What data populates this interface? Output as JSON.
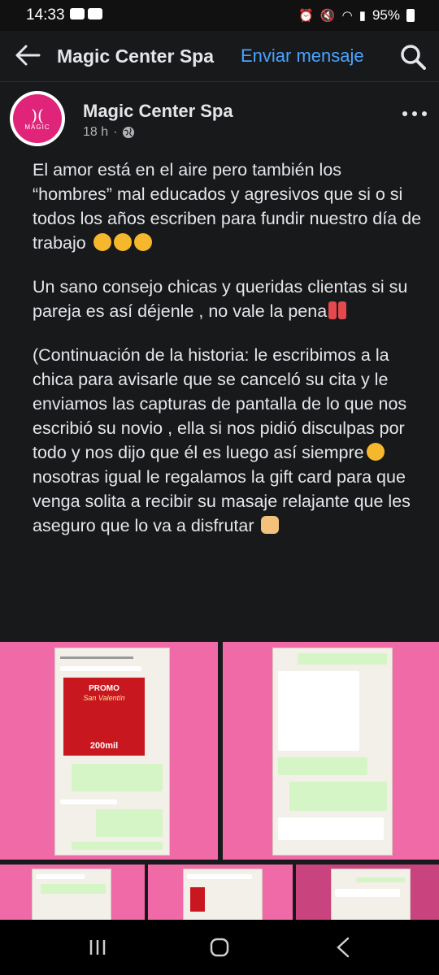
{
  "status_bar": {
    "time": "14:33",
    "battery": "95%"
  },
  "app_bar": {
    "title": "Magic Center Spa",
    "send_message": "Enviar mensaje"
  },
  "post": {
    "author": "Magic Center Spa",
    "time": "18 h",
    "separator": "·",
    "avatar_text": "MAGIC",
    "paragraphs": [
      "El amor está en el aire pero también los “hombres” mal educados y agresivos que si o si todos los años escriben para fundir nuestro día de trabajo",
      "Un sano consejo chicas y queridas clientas si su pareja es así déjenle , no vale la pena",
      "(Continuación de la historia: le escribimos a la chica para avisarle que se canceló su cita y le enviamos las capturas de pantalla de lo que nos escribió su novio , ella si nos pidió disculpas por todo y nos dijo que él es luego así siempre",
      "nosotras igual le regalamos la gift card para que venga solita a recibir su masaje relajante que les aseguro que lo va a disfrutar"
    ]
  },
  "images": {
    "promo_title": "PROMO",
    "promo_sub": "San Valentín",
    "promo_price": "200mil"
  },
  "colors": {
    "background": "#18191a",
    "link": "#4aa3ff",
    "image_bg": "#f06aa7",
    "brand": "#e0247a"
  }
}
